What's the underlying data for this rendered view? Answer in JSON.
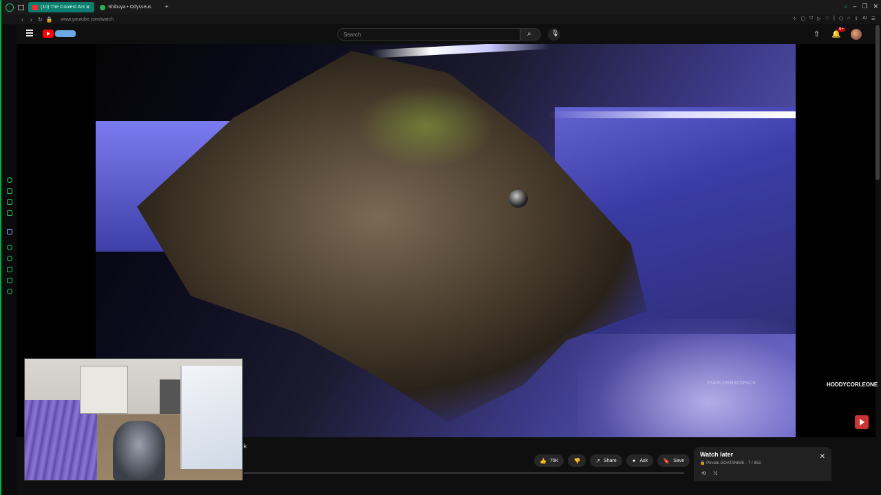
{
  "tabs": [
    {
      "label": "(10) The Coolest Ant",
      "active": true,
      "close": "✕"
    },
    {
      "label": "Shibuya • Odysseus",
      "active": false
    }
  ],
  "new_tab": "+",
  "address": {
    "url": "www.youtube.com/watch",
    "ext_label": "AI"
  },
  "yt": {
    "search_placeholder": "Search",
    "notif_count": "9+"
  },
  "video": {
    "watermark": "STARLINKBACKPACK",
    "channel_tag": "HODDYCORLEONE"
  },
  "below": {
    "partial_char": "k",
    "actions": [
      {
        "icon": "👍",
        "label": "76K",
        "name": "like-button"
      },
      {
        "icon": "👎",
        "label": "",
        "name": "dislike-button"
      },
      {
        "icon": "↗",
        "label": "Share",
        "name": "share-button"
      },
      {
        "icon": "✦",
        "label": "Ask",
        "name": "ask-button"
      },
      {
        "icon": "🔖",
        "label": "Save",
        "name": "save-button"
      },
      {
        "icon": "⋯",
        "label": "",
        "name": "more-button"
      }
    ]
  },
  "watch_later": {
    "title": "Watch later",
    "subtitle": "🔒 Private GOATANIME · 7 / 853",
    "close": "✕",
    "loop": "⟲",
    "shuffle": "⤨"
  }
}
